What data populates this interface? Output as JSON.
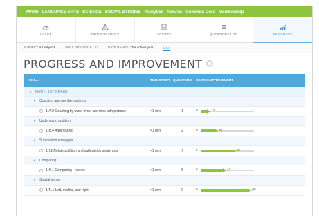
{
  "nav": {
    "items": [
      "MATH",
      "LANGUAGE ARTS",
      "SCIENCE",
      "SOCIAL STUDIES",
      "Analytics",
      "Awards",
      "Common Core",
      "Membership"
    ],
    "bg_color": "#8cc63f"
  },
  "tabs": [
    {
      "label": "USAGE",
      "icon": "usage-icon",
      "active": false
    },
    {
      "label": "TROUBLE SPOTS",
      "icon": "warning-icon",
      "active": false
    },
    {
      "label": "SCORES",
      "icon": "scores-icon",
      "active": false
    },
    {
      "label": "QUESTIONS LOG",
      "icon": "list-icon",
      "active": false
    },
    {
      "label": "PROGRESS",
      "icon": "progress-icon",
      "active": true
    }
  ],
  "filters": {
    "subject_label": "SUBJECT:",
    "subject_value": "All subjects",
    "grades_label": "SKILL GRADES:",
    "grades_value": "K - 12",
    "date_label": "DATE RANGE:",
    "date_value": "This school year",
    "reset": "reset"
  },
  "page_title": "PROGRESS AND IMPROVEMENT",
  "table": {
    "header": {
      "skill": "SKILL",
      "time": "TIME SPENT",
      "questions": "QUESTIONS",
      "score": "SCORE IMPROVEMENT"
    },
    "header_color": "#4ea9dd",
    "section": "MATH - 1ST GRADE",
    "bar_color": "#8cc63f",
    "groups": [
      {
        "name": "Counting and number patterns",
        "skill": "1-A.9 Counting by twos, fives, and tens with pictures",
        "time": "<1 min",
        "questions": "1",
        "start": "0",
        "end": "12",
        "improvement": 12
      },
      {
        "name": "Understand addition",
        "skill": "1-B.4 Adding zero",
        "time": "<1 min",
        "questions": "2",
        "start": "0",
        "end": "26",
        "improvement": 26
      },
      {
        "name": "Subtraction strategies",
        "skill": "1-I.1 Relate addition and subtraction sentences",
        "time": "<1 min",
        "questions": "7",
        "start": "0",
        "end": "60",
        "improvement": 60
      },
      {
        "name": "Comparing",
        "skill": "1-K.1 Comparing - review",
        "time": "<1 min",
        "questions": "5",
        "start": "0",
        "end": "42",
        "improvement": 42
      },
      {
        "name": "Spatial sense",
        "skill": "1-N.1 Left, middle, and right",
        "time": "<1 min",
        "questions": "9",
        "start": "0",
        "end": "90",
        "improvement": 90
      }
    ]
  }
}
